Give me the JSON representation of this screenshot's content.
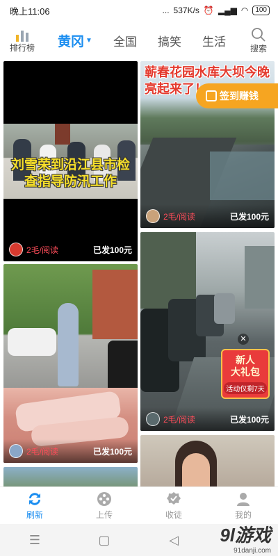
{
  "status_bar": {
    "time": "晚上11:06",
    "dots": "...",
    "speed": "537K/s",
    "battery": "100"
  },
  "nav": {
    "rank_label": "排行榜",
    "tabs": [
      {
        "label": "黄冈",
        "active": true
      },
      {
        "label": "全国",
        "active": false
      },
      {
        "label": "搞笑",
        "active": false
      },
      {
        "label": "生活",
        "active": false
      }
    ],
    "search_label": "搜索"
  },
  "feed": {
    "cards": [
      {
        "title": "刘雪荣到沿江县市检查指导防汛工作",
        "price": "2毛/阅读",
        "sent": "已发100元"
      },
      {
        "title": "蕲春花园水库大坝今晚亮起来了！",
        "price": "2毛/阅读",
        "sent": "已发100元"
      },
      {
        "title": "",
        "price": "2毛/阅读",
        "sent": "已发100元"
      },
      {
        "title": "",
        "price": "2毛/阅读",
        "sent": "已发100元"
      }
    ],
    "signin_banner": "签到赚钱",
    "gift": {
      "title_line1": "新人",
      "title_line2": "大礼包",
      "subtitle": "活动仅剩7天"
    }
  },
  "bottom_nav": {
    "items": [
      {
        "label": "刷新",
        "icon": "refresh-icon",
        "active": true
      },
      {
        "label": "上传",
        "icon": "film-reel-icon",
        "active": false
      },
      {
        "label": "收徒",
        "icon": "badge-check-icon",
        "active": false
      },
      {
        "label": "我的",
        "icon": "user-icon",
        "active": false
      }
    ]
  },
  "watermark": {
    "logo": "9l游戏",
    "url": "91danji.com"
  },
  "colors": {
    "accent": "#1a8df0",
    "price": "#ff4d5a",
    "signin": "#f6a521",
    "gift": "#e93b3b"
  }
}
